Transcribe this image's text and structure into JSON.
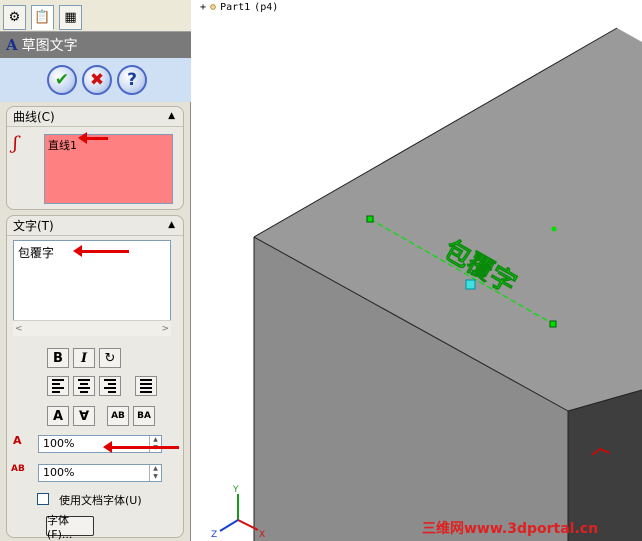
{
  "panel": {
    "tabs": [
      "feature-manager-icon",
      "property-manager-icon",
      "configuration-manager-icon"
    ],
    "title": "草图文字",
    "actions": {
      "ok": "✔",
      "cancel": "✖",
      "help": "?"
    },
    "curves_group": {
      "header": "曲线(C)",
      "items": [
        "直线1"
      ]
    },
    "text_group": {
      "header": "文字(T)",
      "text_value": "包覆字",
      "bold_label": "B",
      "italic_label": "I",
      "rotate_label": "↻",
      "flip_label_1": "A",
      "flip_label_2": "∀",
      "flip_label_3": "AB",
      "flip_label_4": "BA",
      "width_factor": "100%",
      "spacing": "100%",
      "use_doc_font_label": "使用文档字体(U)",
      "use_doc_font_checked": false,
      "font_button": "字体(F)..."
    }
  },
  "graphics": {
    "tree_label": "Part1",
    "tree_config": "(p4)",
    "sketch_text": "包覆字",
    "watermark": "三维网www.3dportal.cn",
    "axis_labels": {
      "x": "X",
      "y": "Y",
      "z": "Z"
    }
  },
  "colors": {
    "selection_box": "#ff8080",
    "sketch_green": "#00e000",
    "annotation_red": "#e00000",
    "model_top": "#9a9a9a",
    "model_left": "#8a8a8a",
    "model_right": "#3e3e3e"
  }
}
